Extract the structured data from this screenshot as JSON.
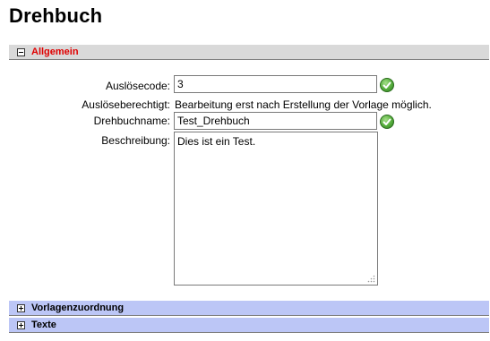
{
  "page": {
    "title": "Drehbuch"
  },
  "sections": {
    "allgemein": {
      "label": "Allgemein",
      "state": "expanded"
    },
    "vorlagenzuordnung": {
      "label": "Vorlagenzuordnung",
      "state": "collapsed"
    },
    "texte": {
      "label": "Texte",
      "state": "collapsed"
    }
  },
  "form": {
    "ausloesecode": {
      "label": "Auslösecode:",
      "value": "3",
      "valid_icon": "check-circle-icon"
    },
    "ausloeseberechtigt": {
      "label": "Auslöseberechtigt:",
      "value": "Bearbeitung erst nach Erstellung der Vorlage möglich."
    },
    "drehbuchname": {
      "label": "Drehbuchname:",
      "value": "Test_Drehbuch",
      "valid_icon": "check-circle-icon"
    },
    "beschreibung": {
      "label": "Beschreibung:",
      "value": "Dies ist ein Test."
    }
  },
  "colors": {
    "section_open_bg": "#d9d9d9",
    "section_open_text": "#e00000",
    "section_closed_bg": "#bcc6f6",
    "valid_green": "#55ad3c"
  }
}
